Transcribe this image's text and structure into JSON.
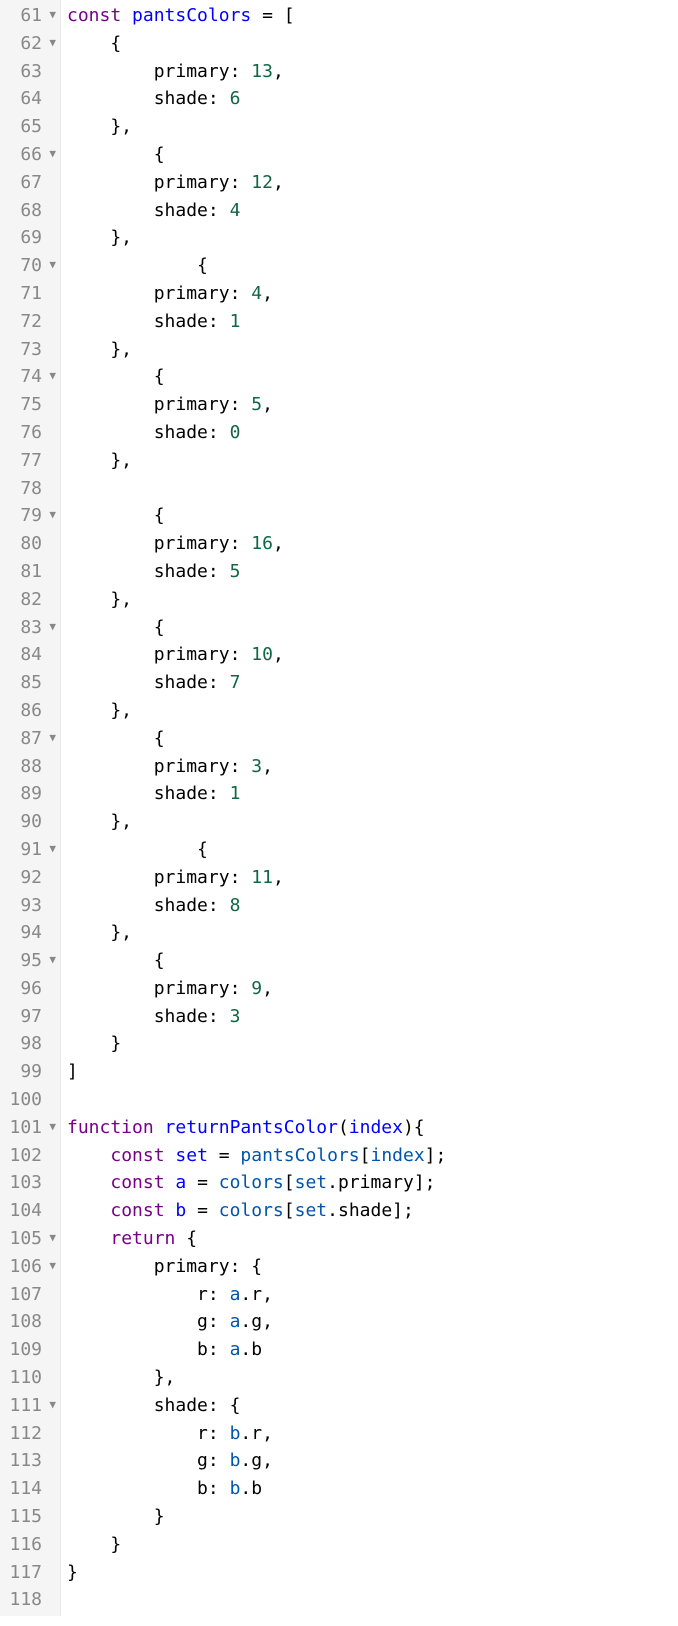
{
  "lines": [
    {
      "n": 61,
      "fold": "▼",
      "tokens": [
        [
          "kw",
          "const"
        ],
        [
          "punct",
          " "
        ],
        [
          "def",
          "pantsColors"
        ],
        [
          "punct",
          " = ["
        ]
      ]
    },
    {
      "n": 62,
      "fold": "▼",
      "tokens": [
        [
          "punct",
          "    {"
        ]
      ]
    },
    {
      "n": 63,
      "fold": "",
      "tokens": [
        [
          "punct",
          "        "
        ],
        [
          "prop",
          "primary"
        ],
        [
          "punct",
          ": "
        ],
        [
          "num",
          "13"
        ],
        [
          "punct",
          ","
        ]
      ]
    },
    {
      "n": 64,
      "fold": "",
      "tokens": [
        [
          "punct",
          "        "
        ],
        [
          "prop",
          "shade"
        ],
        [
          "punct",
          ": "
        ],
        [
          "num",
          "6"
        ]
      ]
    },
    {
      "n": 65,
      "fold": "",
      "tokens": [
        [
          "punct",
          "    },"
        ]
      ]
    },
    {
      "n": 66,
      "fold": "▼",
      "tokens": [
        [
          "punct",
          "        {"
        ]
      ]
    },
    {
      "n": 67,
      "fold": "",
      "tokens": [
        [
          "punct",
          "        "
        ],
        [
          "prop",
          "primary"
        ],
        [
          "punct",
          ": "
        ],
        [
          "num",
          "12"
        ],
        [
          "punct",
          ","
        ]
      ]
    },
    {
      "n": 68,
      "fold": "",
      "tokens": [
        [
          "punct",
          "        "
        ],
        [
          "prop",
          "shade"
        ],
        [
          "punct",
          ": "
        ],
        [
          "num",
          "4"
        ]
      ]
    },
    {
      "n": 69,
      "fold": "",
      "tokens": [
        [
          "punct",
          "    },"
        ]
      ]
    },
    {
      "n": 70,
      "fold": "▼",
      "tokens": [
        [
          "punct",
          "            {"
        ]
      ]
    },
    {
      "n": 71,
      "fold": "",
      "tokens": [
        [
          "punct",
          "        "
        ],
        [
          "prop",
          "primary"
        ],
        [
          "punct",
          ": "
        ],
        [
          "num",
          "4"
        ],
        [
          "punct",
          ","
        ]
      ]
    },
    {
      "n": 72,
      "fold": "",
      "tokens": [
        [
          "punct",
          "        "
        ],
        [
          "prop",
          "shade"
        ],
        [
          "punct",
          ": "
        ],
        [
          "num",
          "1"
        ]
      ]
    },
    {
      "n": 73,
      "fold": "",
      "tokens": [
        [
          "punct",
          "    },"
        ]
      ]
    },
    {
      "n": 74,
      "fold": "▼",
      "tokens": [
        [
          "punct",
          "        {"
        ]
      ]
    },
    {
      "n": 75,
      "fold": "",
      "tokens": [
        [
          "punct",
          "        "
        ],
        [
          "prop",
          "primary"
        ],
        [
          "punct",
          ": "
        ],
        [
          "num",
          "5"
        ],
        [
          "punct",
          ","
        ]
      ]
    },
    {
      "n": 76,
      "fold": "",
      "tokens": [
        [
          "punct",
          "        "
        ],
        [
          "prop",
          "shade"
        ],
        [
          "punct",
          ": "
        ],
        [
          "num",
          "0"
        ]
      ]
    },
    {
      "n": 77,
      "fold": "",
      "tokens": [
        [
          "punct",
          "    },"
        ]
      ]
    },
    {
      "n": 78,
      "fold": "",
      "tokens": []
    },
    {
      "n": 79,
      "fold": "▼",
      "tokens": [
        [
          "punct",
          "        {"
        ]
      ]
    },
    {
      "n": 80,
      "fold": "",
      "tokens": [
        [
          "punct",
          "        "
        ],
        [
          "prop",
          "primary"
        ],
        [
          "punct",
          ": "
        ],
        [
          "num",
          "16"
        ],
        [
          "punct",
          ","
        ]
      ]
    },
    {
      "n": 81,
      "fold": "",
      "tokens": [
        [
          "punct",
          "        "
        ],
        [
          "prop",
          "shade"
        ],
        [
          "punct",
          ": "
        ],
        [
          "num",
          "5"
        ]
      ]
    },
    {
      "n": 82,
      "fold": "",
      "tokens": [
        [
          "punct",
          "    },"
        ]
      ]
    },
    {
      "n": 83,
      "fold": "▼",
      "tokens": [
        [
          "punct",
          "        {"
        ]
      ]
    },
    {
      "n": 84,
      "fold": "",
      "tokens": [
        [
          "punct",
          "        "
        ],
        [
          "prop",
          "primary"
        ],
        [
          "punct",
          ": "
        ],
        [
          "num",
          "10"
        ],
        [
          "punct",
          ","
        ]
      ]
    },
    {
      "n": 85,
      "fold": "",
      "tokens": [
        [
          "punct",
          "        "
        ],
        [
          "prop",
          "shade"
        ],
        [
          "punct",
          ": "
        ],
        [
          "num",
          "7"
        ]
      ]
    },
    {
      "n": 86,
      "fold": "",
      "tokens": [
        [
          "punct",
          "    },"
        ]
      ]
    },
    {
      "n": 87,
      "fold": "▼",
      "tokens": [
        [
          "punct",
          "        {"
        ]
      ]
    },
    {
      "n": 88,
      "fold": "",
      "tokens": [
        [
          "punct",
          "        "
        ],
        [
          "prop",
          "primary"
        ],
        [
          "punct",
          ": "
        ],
        [
          "num",
          "3"
        ],
        [
          "punct",
          ","
        ]
      ]
    },
    {
      "n": 89,
      "fold": "",
      "tokens": [
        [
          "punct",
          "        "
        ],
        [
          "prop",
          "shade"
        ],
        [
          "punct",
          ": "
        ],
        [
          "num",
          "1"
        ]
      ]
    },
    {
      "n": 90,
      "fold": "",
      "tokens": [
        [
          "punct",
          "    },"
        ]
      ]
    },
    {
      "n": 91,
      "fold": "▼",
      "tokens": [
        [
          "punct",
          "            {"
        ]
      ]
    },
    {
      "n": 92,
      "fold": "",
      "tokens": [
        [
          "punct",
          "        "
        ],
        [
          "prop",
          "primary"
        ],
        [
          "punct",
          ": "
        ],
        [
          "num",
          "11"
        ],
        [
          "punct",
          ","
        ]
      ]
    },
    {
      "n": 93,
      "fold": "",
      "tokens": [
        [
          "punct",
          "        "
        ],
        [
          "prop",
          "shade"
        ],
        [
          "punct",
          ": "
        ],
        [
          "num",
          "8"
        ]
      ]
    },
    {
      "n": 94,
      "fold": "",
      "tokens": [
        [
          "punct",
          "    },"
        ]
      ]
    },
    {
      "n": 95,
      "fold": "▼",
      "tokens": [
        [
          "punct",
          "        {"
        ]
      ]
    },
    {
      "n": 96,
      "fold": "",
      "tokens": [
        [
          "punct",
          "        "
        ],
        [
          "prop",
          "primary"
        ],
        [
          "punct",
          ": "
        ],
        [
          "num",
          "9"
        ],
        [
          "punct",
          ","
        ]
      ]
    },
    {
      "n": 97,
      "fold": "",
      "tokens": [
        [
          "punct",
          "        "
        ],
        [
          "prop",
          "shade"
        ],
        [
          "punct",
          ": "
        ],
        [
          "num",
          "3"
        ]
      ]
    },
    {
      "n": 98,
      "fold": "",
      "tokens": [
        [
          "punct",
          "    }"
        ]
      ]
    },
    {
      "n": 99,
      "fold": "",
      "tokens": [
        [
          "punct",
          "]"
        ]
      ]
    },
    {
      "n": 100,
      "fold": "",
      "tokens": []
    },
    {
      "n": 101,
      "fold": "▼",
      "tokens": [
        [
          "kw",
          "function"
        ],
        [
          "punct",
          " "
        ],
        [
          "def",
          "returnPantsColor"
        ],
        [
          "punct",
          "("
        ],
        [
          "def",
          "index"
        ],
        [
          "punct",
          "){"
        ]
      ]
    },
    {
      "n": 102,
      "fold": "",
      "tokens": [
        [
          "punct",
          "    "
        ],
        [
          "kw",
          "const"
        ],
        [
          "punct",
          " "
        ],
        [
          "def",
          "set"
        ],
        [
          "punct",
          " = "
        ],
        [
          "var2",
          "pantsColors"
        ],
        [
          "punct",
          "["
        ],
        [
          "var2",
          "index"
        ],
        [
          "punct",
          "];"
        ]
      ]
    },
    {
      "n": 103,
      "fold": "",
      "tokens": [
        [
          "punct",
          "    "
        ],
        [
          "kw",
          "const"
        ],
        [
          "punct",
          " "
        ],
        [
          "def",
          "a"
        ],
        [
          "punct",
          " = "
        ],
        [
          "var2",
          "colors"
        ],
        [
          "punct",
          "["
        ],
        [
          "var2",
          "set"
        ],
        [
          "punct",
          "."
        ],
        [
          "prop",
          "primary"
        ],
        [
          "punct",
          "];"
        ]
      ]
    },
    {
      "n": 104,
      "fold": "",
      "tokens": [
        [
          "punct",
          "    "
        ],
        [
          "kw",
          "const"
        ],
        [
          "punct",
          " "
        ],
        [
          "def",
          "b"
        ],
        [
          "punct",
          " = "
        ],
        [
          "var2",
          "colors"
        ],
        [
          "punct",
          "["
        ],
        [
          "var2",
          "set"
        ],
        [
          "punct",
          "."
        ],
        [
          "prop",
          "shade"
        ],
        [
          "punct",
          "];"
        ]
      ]
    },
    {
      "n": 105,
      "fold": "▼",
      "tokens": [
        [
          "punct",
          "    "
        ],
        [
          "kw",
          "return"
        ],
        [
          "punct",
          " {"
        ]
      ]
    },
    {
      "n": 106,
      "fold": "▼",
      "tokens": [
        [
          "punct",
          "        "
        ],
        [
          "prop",
          "primary"
        ],
        [
          "punct",
          ": {"
        ]
      ]
    },
    {
      "n": 107,
      "fold": "",
      "tokens": [
        [
          "punct",
          "            "
        ],
        [
          "prop",
          "r"
        ],
        [
          "punct",
          ": "
        ],
        [
          "var2",
          "a"
        ],
        [
          "punct",
          "."
        ],
        [
          "prop",
          "r"
        ],
        [
          "punct",
          ","
        ]
      ]
    },
    {
      "n": 108,
      "fold": "",
      "tokens": [
        [
          "punct",
          "            "
        ],
        [
          "prop",
          "g"
        ],
        [
          "punct",
          ": "
        ],
        [
          "var2",
          "a"
        ],
        [
          "punct",
          "."
        ],
        [
          "prop",
          "g"
        ],
        [
          "punct",
          ","
        ]
      ]
    },
    {
      "n": 109,
      "fold": "",
      "tokens": [
        [
          "punct",
          "            "
        ],
        [
          "prop",
          "b"
        ],
        [
          "punct",
          ": "
        ],
        [
          "var2",
          "a"
        ],
        [
          "punct",
          "."
        ],
        [
          "prop",
          "b"
        ]
      ]
    },
    {
      "n": 110,
      "fold": "",
      "tokens": [
        [
          "punct",
          "        },"
        ]
      ]
    },
    {
      "n": 111,
      "fold": "▼",
      "tokens": [
        [
          "punct",
          "        "
        ],
        [
          "prop",
          "shade"
        ],
        [
          "punct",
          ": {"
        ]
      ]
    },
    {
      "n": 112,
      "fold": "",
      "tokens": [
        [
          "punct",
          "            "
        ],
        [
          "prop",
          "r"
        ],
        [
          "punct",
          ": "
        ],
        [
          "var2",
          "b"
        ],
        [
          "punct",
          "."
        ],
        [
          "prop",
          "r"
        ],
        [
          "punct",
          ","
        ]
      ]
    },
    {
      "n": 113,
      "fold": "",
      "tokens": [
        [
          "punct",
          "            "
        ],
        [
          "prop",
          "g"
        ],
        [
          "punct",
          ": "
        ],
        [
          "var2",
          "b"
        ],
        [
          "punct",
          "."
        ],
        [
          "prop",
          "g"
        ],
        [
          "punct",
          ","
        ]
      ]
    },
    {
      "n": 114,
      "fold": "",
      "tokens": [
        [
          "punct",
          "            "
        ],
        [
          "prop",
          "b"
        ],
        [
          "punct",
          ": "
        ],
        [
          "var2",
          "b"
        ],
        [
          "punct",
          "."
        ],
        [
          "prop",
          "b"
        ]
      ]
    },
    {
      "n": 115,
      "fold": "",
      "tokens": [
        [
          "punct",
          "        }"
        ]
      ]
    },
    {
      "n": 116,
      "fold": "",
      "tokens": [
        [
          "punct",
          "    }"
        ]
      ]
    },
    {
      "n": 117,
      "fold": "",
      "tokens": [
        [
          "punct",
          "}"
        ]
      ]
    },
    {
      "n": 118,
      "fold": "",
      "tokens": []
    }
  ]
}
